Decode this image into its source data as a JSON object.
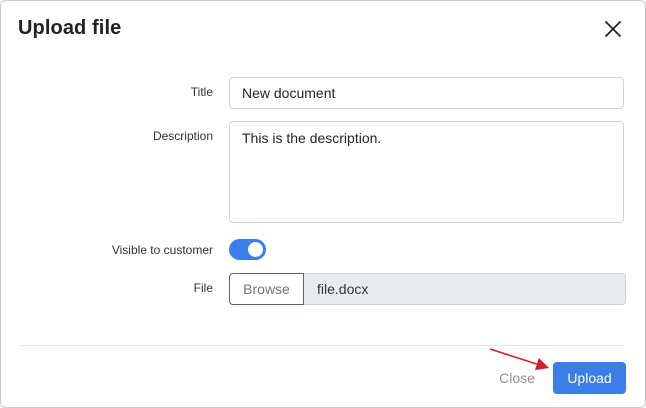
{
  "dialog": {
    "title": "Upload file"
  },
  "form": {
    "title_label": "Title",
    "title_value": "New document",
    "description_label": "Description",
    "description_value": "This is the description.",
    "visible_label": "Visible to customer",
    "visible_on": true,
    "file_label": "File",
    "browse_label": "Browse",
    "file_name": "file.docx"
  },
  "footer": {
    "close_label": "Close",
    "upload_label": "Upload"
  },
  "colors": {
    "accent": "#3b7de9",
    "annotation_arrow": "#d0202a"
  },
  "icons": {
    "close": "close-icon",
    "annotation": "red-arrow-icon"
  }
}
